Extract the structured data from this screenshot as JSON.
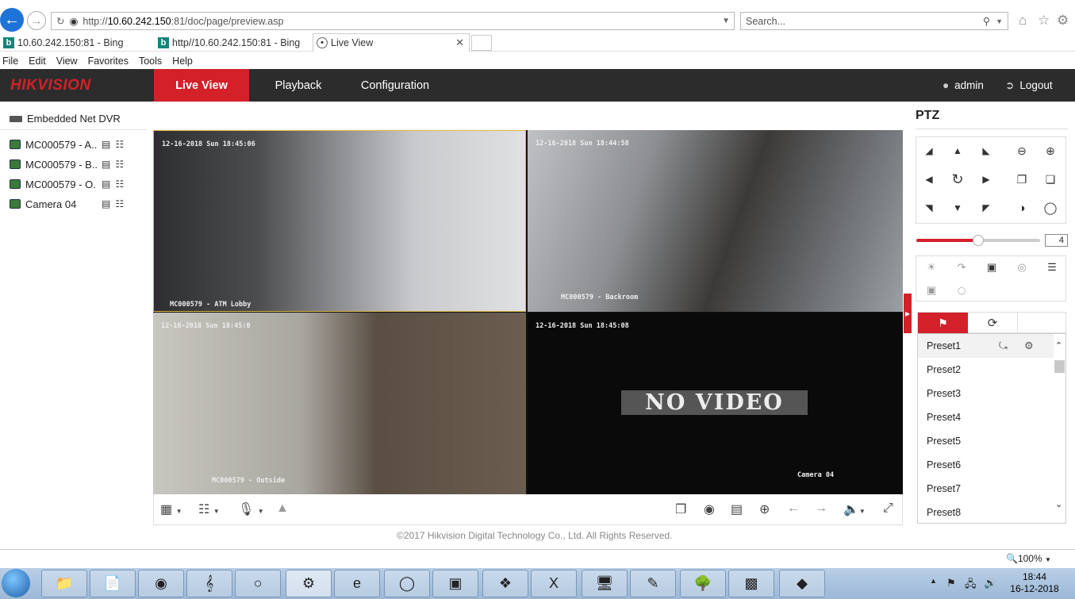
{
  "browser": {
    "url_prefix": "http://",
    "url_host": "10.60.242.150",
    "url_path": ":81/doc/page/preview.asp",
    "search_placeholder": "Search...",
    "tabs": [
      {
        "label": "10.60.242.150:81 - Bing",
        "favicon": "b"
      },
      {
        "label": "http//10.60.242.150:81 - Bing",
        "favicon": "b"
      },
      {
        "label": "Live View",
        "favicon": "web"
      }
    ],
    "menu": [
      "File",
      "Edit",
      "View",
      "Favorites",
      "Tools",
      "Help"
    ]
  },
  "app": {
    "logo": "HIKVISION",
    "nav": {
      "live": "Live View",
      "playback": "Playback",
      "configuration": "Configuration"
    },
    "user": "admin",
    "logout": "Logout",
    "accent": "#d32029"
  },
  "sidebar": {
    "device": "Embedded Net DVR",
    "cameras": [
      {
        "name": "MC000579 - A..."
      },
      {
        "name": "MC000579 - B..."
      },
      {
        "name": "MC000579 - O..."
      },
      {
        "name": "Camera 04"
      }
    ]
  },
  "video": {
    "tiles": [
      {
        "timestamp": "12-16-2018 Sun 18:45:06",
        "caption": "MC000579 - ATM Lobby"
      },
      {
        "timestamp": "12-16-2018 Sun 18:44:58",
        "caption": "MC000579 - Backroom"
      },
      {
        "timestamp": "12-16-2018 Sun 18:45:0",
        "caption": "MC000579 - Outside"
      },
      {
        "timestamp": "12-16-2018 Sun 18:45:08",
        "caption": "Camera 04",
        "no_video": "NO VIDEO"
      }
    ]
  },
  "footer": {
    "copyright": "©2017 Hikvision Digital Technology Co., Ltd. All Rights Reserved."
  },
  "ptz": {
    "title": "PTZ",
    "speed": 4,
    "speed_fraction": 0.5,
    "presets": [
      "Preset1",
      "Preset2",
      "Preset3",
      "Preset4",
      "Preset5",
      "Preset6",
      "Preset7",
      "Preset8"
    ]
  },
  "statusbar": {
    "zoom": "100%"
  },
  "taskbar": {
    "time": "18:44",
    "date": "16-12-2018"
  }
}
